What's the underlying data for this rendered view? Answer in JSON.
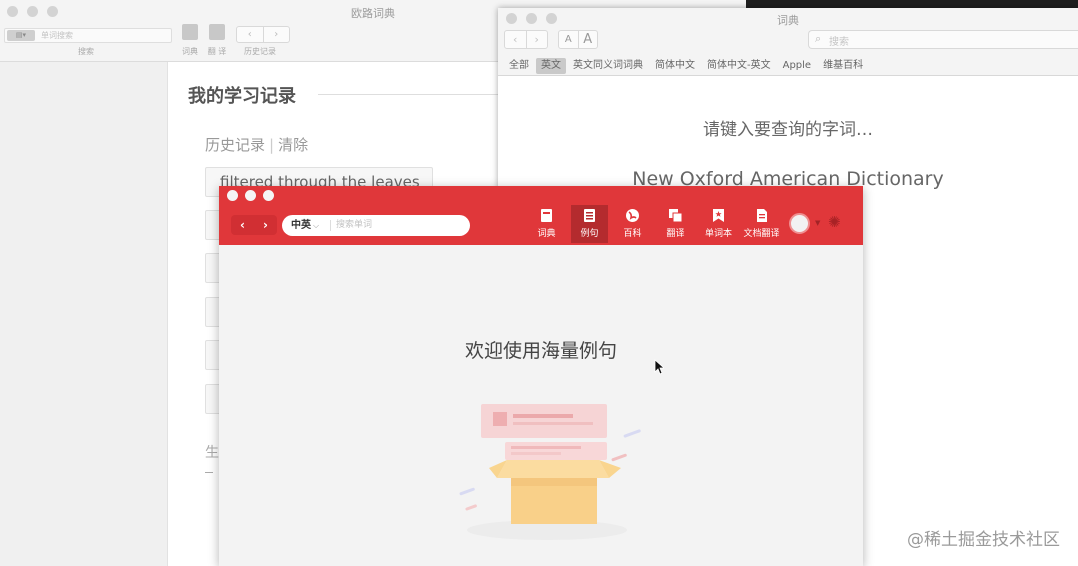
{
  "eudic": {
    "title": "欧路词典",
    "search_placeholder": "单词搜索",
    "search_label": "搜索",
    "tool_dict": "词典",
    "tool_fanyi": "翻 译",
    "tool_history": "历史记录",
    "study_title": "我的学习记录",
    "history_label": "历史记录",
    "history_sep": "|",
    "clear_label": "清除",
    "history_first": "filtered through the leaves",
    "cut_text": "生"
  },
  "dictionary": {
    "title": "词典",
    "search_placeholder": "搜索",
    "font_small": "A",
    "font_large": "A",
    "tabs": [
      "全部",
      "英文",
      "英文同义词词典",
      "简体中文",
      "简体中文-英文",
      "Apple",
      "维基百科"
    ],
    "active_tab": "英文",
    "prompt": "请键入要查询的字词…",
    "dictionary_name": "New Oxford American Dictionary"
  },
  "youdao": {
    "back": "‹",
    "forward": "›",
    "lang": "中英",
    "search_placeholder": "搜索单词",
    "tools": [
      {
        "label": "词典",
        "icon": "book-icon"
      },
      {
        "label": "例句",
        "icon": "list-icon"
      },
      {
        "label": "百科",
        "icon": "globe-icon"
      },
      {
        "label": "翻译",
        "icon": "translate-icon"
      },
      {
        "label": "单词本",
        "icon": "wordbook-icon"
      },
      {
        "label": "文档翻译",
        "icon": "document-icon"
      }
    ],
    "active_tool": "例句",
    "welcome": "欢迎使用海量例句"
  },
  "watermark": "@稀土掘金技术社区",
  "colors": {
    "youdao_red": "#e0373a",
    "youdao_active": "#b42b2e",
    "window_chrome": "#f4f4f4"
  }
}
